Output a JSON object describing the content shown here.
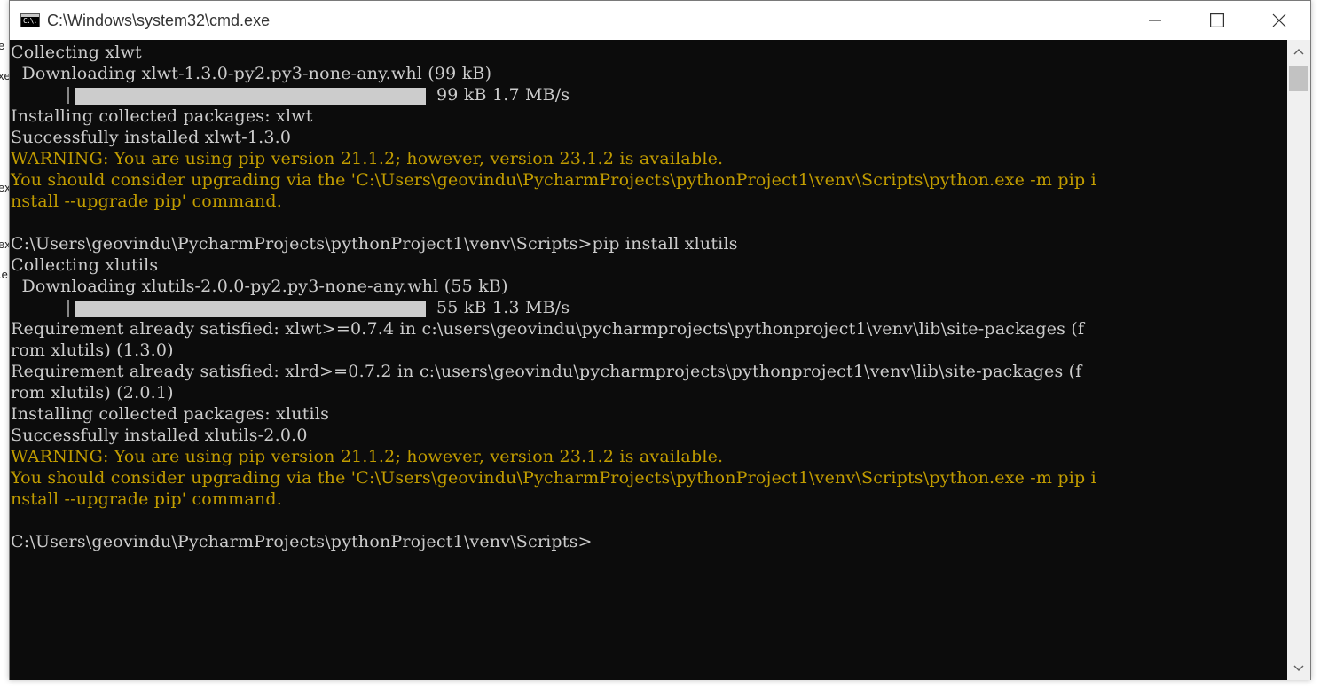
{
  "background_fragments": [
    "e",
    "xe",
    "ex",
    "ex",
    ".e"
  ],
  "window": {
    "title": "C:\\Windows\\system32\\cmd.exe",
    "icon_text": "C:\\."
  },
  "colors": {
    "terminal_bg": "#0c0c0c",
    "normal_text": "#cccccc",
    "warning_text": "#c19c00"
  },
  "terminal": {
    "lines": [
      {
        "text": "Collecting xlwt",
        "style": "normal"
      },
      {
        "text": "  Downloading xlwt-1.3.0-py2.py3-none-any.whl (99 kB)",
        "style": "normal"
      },
      {
        "text": "",
        "style": "normal",
        "progress": {
          "value": 1.0,
          "text": "99 kB 1.7 MB/s"
        }
      },
      {
        "text": "Installing collected packages: xlwt",
        "style": "normal"
      },
      {
        "text": "Successfully installed xlwt-1.3.0",
        "style": "normal"
      },
      {
        "text": "WARNING: You are using pip version 21.1.2; however, version 23.1.2 is available.",
        "style": "warn"
      },
      {
        "text": "You should consider upgrading via the 'C:\\Users\\geovindu\\PycharmProjects\\pythonProject1\\venv\\Scripts\\python.exe -m pip i",
        "style": "warn"
      },
      {
        "text": "nstall --upgrade pip' command.",
        "style": "warn"
      },
      {
        "text": "",
        "style": "normal"
      },
      {
        "text": "C:\\Users\\geovindu\\PycharmProjects\\pythonProject1\\venv\\Scripts>pip install xlutils",
        "style": "normal"
      },
      {
        "text": "Collecting xlutils",
        "style": "normal"
      },
      {
        "text": "  Downloading xlutils-2.0.0-py2.py3-none-any.whl (55 kB)",
        "style": "normal"
      },
      {
        "text": "",
        "style": "normal",
        "progress": {
          "value": 1.0,
          "text": "55 kB 1.3 MB/s"
        }
      },
      {
        "text": "Requirement already satisfied: xlwt>=0.7.4 in c:\\users\\geovindu\\pycharmprojects\\pythonproject1\\venv\\lib\\site-packages (f",
        "style": "normal"
      },
      {
        "text": "rom xlutils) (1.3.0)",
        "style": "normal"
      },
      {
        "text": "Requirement already satisfied: xlrd>=0.7.2 in c:\\users\\geovindu\\pycharmprojects\\pythonproject1\\venv\\lib\\site-packages (f",
        "style": "normal"
      },
      {
        "text": "rom xlutils) (2.0.1)",
        "style": "normal"
      },
      {
        "text": "Installing collected packages: xlutils",
        "style": "normal"
      },
      {
        "text": "Successfully installed xlutils-2.0.0",
        "style": "normal"
      },
      {
        "text": "WARNING: You are using pip version 21.1.2; however, version 23.1.2 is available.",
        "style": "warn"
      },
      {
        "text": "You should consider upgrading via the 'C:\\Users\\geovindu\\PycharmProjects\\pythonProject1\\venv\\Scripts\\python.exe -m pip i",
        "style": "warn"
      },
      {
        "text": "nstall --upgrade pip' command.",
        "style": "warn"
      },
      {
        "text": "",
        "style": "normal"
      },
      {
        "text": "C:\\Users\\geovindu\\PycharmProjects\\pythonProject1\\venv\\Scripts>",
        "style": "normal"
      }
    ]
  },
  "window_controls": {
    "minimize_icon": "minimize-icon",
    "maximize_icon": "maximize-icon",
    "close_icon": "close-icon"
  },
  "scrollbar": {
    "up_icon": "chevron-up-icon",
    "down_icon": "chevron-down-icon",
    "position": 0.0
  }
}
